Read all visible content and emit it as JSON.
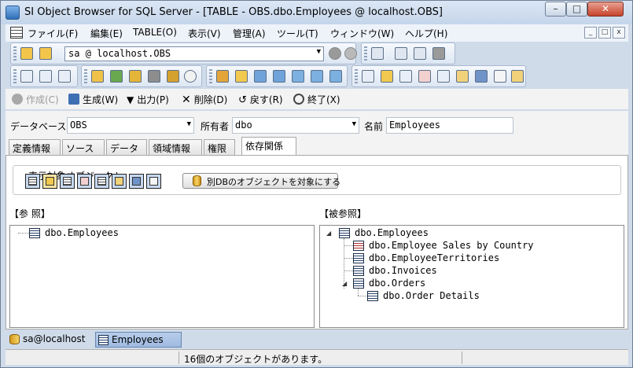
{
  "window": {
    "title": "SI Object Browser for SQL Server - [TABLE - OBS.dbo.Employees @ localhost.OBS]"
  },
  "window_controls": {
    "minimize": "–",
    "maximize": "□",
    "close": "✕"
  },
  "menu": {
    "items": [
      "ファイル(F)",
      "編集(E)",
      "TABLE(O)",
      "表示(V)",
      "管理(A)",
      "ツール(T)",
      "ウィンドウ(W)",
      "ヘルプ(H)"
    ],
    "mdi_controls": [
      "_",
      "□",
      "x"
    ]
  },
  "toolbar": {
    "connection": "sa @ localhost.OBS"
  },
  "actions": {
    "create": "作成(C)",
    "generate": "生成(W)",
    "output": "出力(P)",
    "delete": "削除(D)",
    "revert": "戻す(R)",
    "exit": "終了(X)"
  },
  "properties": {
    "database_label": "データベース",
    "database_value": "OBS",
    "owner_label": "所有者",
    "owner_value": "dbo",
    "name_label": "名前",
    "name_value": "Employees"
  },
  "tabs": [
    "定義情報",
    "ソース",
    "データ",
    "領域情報",
    "権限",
    "依存関係"
  ],
  "active_tab": "依存関係",
  "filter": {
    "title": "表示対象オブジェクト",
    "other_db_button": "別DBのオブジェクトを対象にする"
  },
  "references": {
    "label": "【参 照】",
    "nodes": [
      {
        "text": "dbo.Employees",
        "icon": "table-icon"
      }
    ]
  },
  "referenced_by": {
    "label": "【被参照】",
    "nodes": [
      {
        "text": "dbo.Employees",
        "icon": "table-icon",
        "level": 0,
        "expanded": true
      },
      {
        "text": "dbo.Employee Sales by Country",
        "icon": "view-icon",
        "level": 1
      },
      {
        "text": "dbo.EmployeeTerritories",
        "icon": "table-icon",
        "level": 1
      },
      {
        "text": "dbo.Invoices",
        "icon": "view-icon",
        "level": 1
      },
      {
        "text": "dbo.Orders",
        "icon": "table-icon",
        "level": 1,
        "expanded": true
      },
      {
        "text": "dbo.Order Details",
        "icon": "table-icon",
        "level": 2
      }
    ]
  },
  "taskbar": {
    "connection": "sa@localhost",
    "window": "Employees"
  },
  "status": {
    "message": "16個のオブジェクトがあります。"
  }
}
